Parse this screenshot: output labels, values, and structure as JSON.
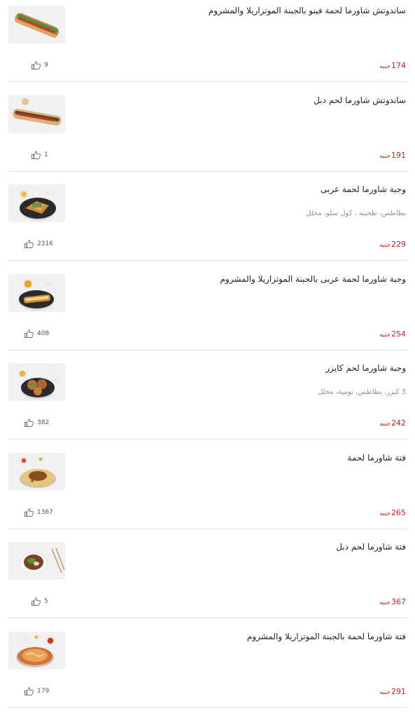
{
  "currency": "جنيه",
  "items": [
    {
      "name": "ساندوتش شاورما لحمة فينو بالجبنة الموتزاريلا والمشروم",
      "desc": "",
      "price": "174",
      "likes": "9",
      "photo": "sandwich-fino"
    },
    {
      "name": "ساندوتش شاورما لحم دبل",
      "desc": "",
      "price": "191",
      "likes": "1",
      "photo": "sandwich-double"
    },
    {
      "name": "وجبة شاورما لحمة عربى",
      "desc": "بطاطس، طحينه ، كول سلو، مخلل",
      "price": "229",
      "likes": "2316",
      "photo": "meal-arabic"
    },
    {
      "name": "وجبة شاورما لحمة عربى بالجبنة الموتزاريلا والمشروم",
      "desc": "",
      "price": "254",
      "likes": "408",
      "photo": "meal-arabic-cheese"
    },
    {
      "name": "وجبة شاورما لحم كايزر",
      "desc": "3 كيزر، بطاطس، ثومية، مخلل",
      "price": "242",
      "likes": "382",
      "photo": "meal-kaiser"
    },
    {
      "name": "فتة شاورما لحمة",
      "desc": "",
      "price": "265",
      "likes": "1367",
      "photo": "fatta"
    },
    {
      "name": "فتة شاورما لحم دبل",
      "desc": "",
      "price": "367",
      "likes": "5",
      "photo": "fatta-double"
    },
    {
      "name": "فتة شاورما لحمة بالجبنة الموتزاريلا والمشروم",
      "desc": "",
      "price": "291",
      "likes": "179",
      "photo": "fatta-cheese"
    }
  ],
  "colors": {
    "price": "#c8211f",
    "text": "#222222",
    "muted": "#8f8f8f",
    "divider": "#e4e4e4"
  },
  "icons": {
    "like": "thumbs-up-icon"
  }
}
